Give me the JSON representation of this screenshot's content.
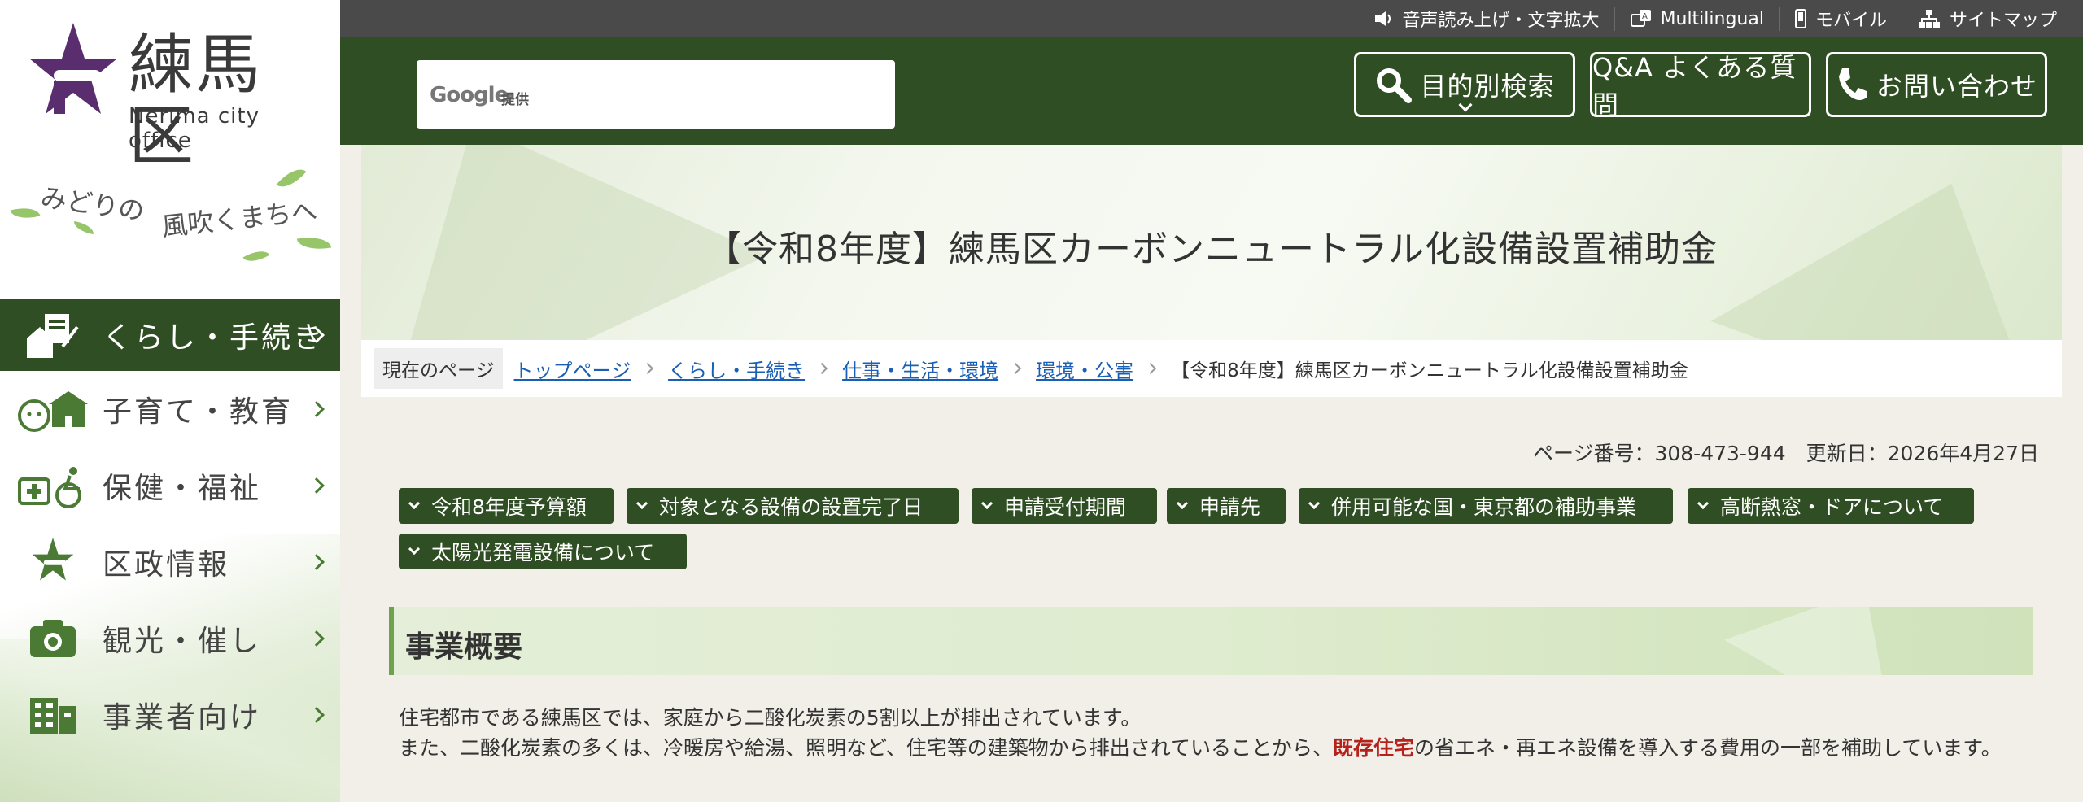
{
  "topbar": {
    "links": [
      {
        "label": "音声読み上げ・文字拡大",
        "icon": "speaker-icon"
      },
      {
        "label": "Multilingual",
        "icon": "translate-icon"
      },
      {
        "label": "モバイル",
        "icon": "mobile-icon"
      },
      {
        "label": "サイトマップ",
        "icon": "sitemap-icon"
      }
    ]
  },
  "logo": {
    "name_ja": "練馬区",
    "name_en": "Nerima city office"
  },
  "slogan": {
    "part1": "みどりの",
    "part2": "風吹く",
    "part3": "まちへ"
  },
  "nav": {
    "items": [
      {
        "label": "くらし・手続き"
      },
      {
        "label": "子育て・教育"
      },
      {
        "label": "保健・福祉"
      },
      {
        "label": "区政情報"
      },
      {
        "label": "観光・催し"
      },
      {
        "label": "事業者向け"
      }
    ]
  },
  "search": {
    "provider": "Google",
    "provider_suffix": "提供"
  },
  "header_buttons": {
    "purpose_search": "目的別検索",
    "faq": "Q&A よくある質問",
    "contact": "お問い合わせ"
  },
  "page": {
    "title": "【令和8年度】練馬区カーボンニュートラル化設備設置補助金",
    "meta": "ページ番号：308-473-944　更新日：2026年4月27日"
  },
  "breadcrumb": {
    "label": "現在のページ",
    "links": [
      "トップページ",
      "くらし・手続き",
      "仕事・生活・環境",
      "環境・公害"
    ],
    "current": "【令和8年度】練馬区カーボンニュートラル化設備設置補助金"
  },
  "anchors": [
    "令和8年度予算額",
    "対象となる設備の設置完了日",
    "申請受付期間",
    "申請先",
    "併用可能な国・東京都の補助事業",
    "高断熱窓・ドアについて",
    "太陽光発電設備について"
  ],
  "section": {
    "title": "事業概要",
    "line1": "住宅都市である練馬区では、家庭から二酸化炭素の5割以上が排出されています。",
    "line2_pre": "また、二酸化炭素の多くは、冷暖房や給湯、照明など、住宅等の建築物から排出されていることから、",
    "line2_em": "既存住宅",
    "line2_post": "の省エネ・再エネ設備を導入する費用の一部を補助しています。"
  },
  "colors": {
    "header_green": "#2f4e23",
    "topbar_gray": "#4a4a4a",
    "emphasis_red": "#b5221b",
    "link_blue": "#1a5fb4"
  }
}
